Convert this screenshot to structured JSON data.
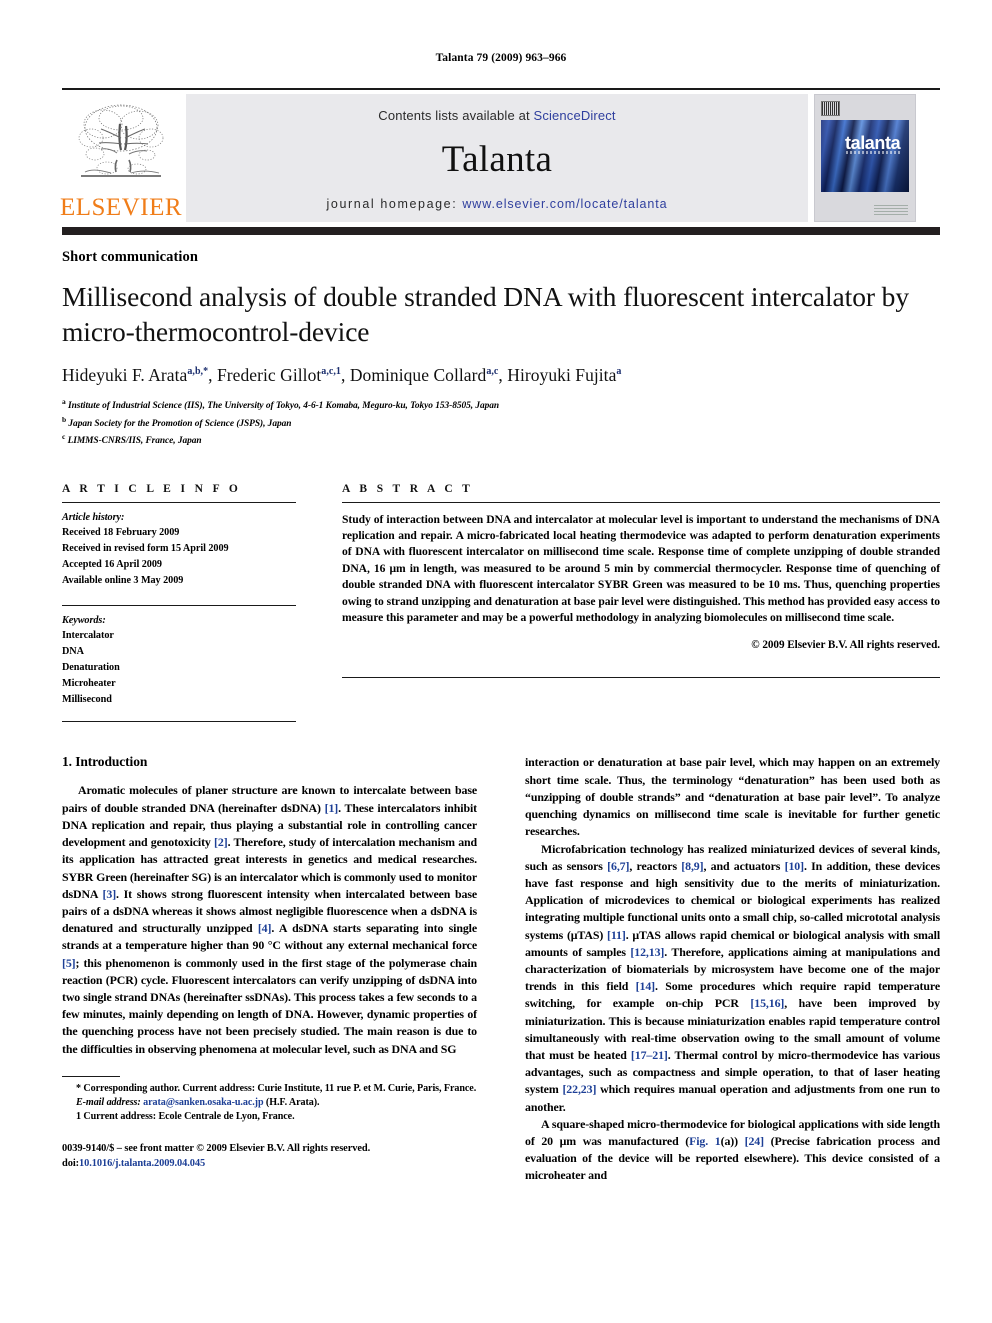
{
  "running_head": "Talanta 79 (2009) 963–966",
  "masthead": {
    "publisher_logo_text": "ELSEVIER",
    "contents_prefix": "Contents lists available at ",
    "contents_link": "ScienceDirect",
    "journal_name": "Talanta",
    "homepage_prefix": "journal homepage: ",
    "homepage_url": "www.elsevier.com/locate/talanta",
    "cover_title": "talanta",
    "accent_orange": "#f07d19",
    "link_blue": "#2f3f9e",
    "panel_gray": "#e9e9ec",
    "band_dark": "#231f20"
  },
  "doc_type": "Short communication",
  "title": "Millisecond analysis of double stranded DNA with fluorescent intercalator by micro-thermocontrol-device",
  "authors": [
    {
      "name": "Hideyuki F. Arata",
      "sup": "a,b,*"
    },
    {
      "name": "Frederic Gillot",
      "sup": "a,c,1"
    },
    {
      "name": "Dominique Collard",
      "sup": "a,c"
    },
    {
      "name": "Hiroyuki Fujita",
      "sup": "a"
    }
  ],
  "affiliations": [
    {
      "mark": "a",
      "text": "Institute of Industrial Science (IIS), The University of Tokyo, 4-6-1 Komaba, Meguro-ku, Tokyo 153-8505, Japan"
    },
    {
      "mark": "b",
      "text": "Japan Society for the Promotion of Science (JSPS), Japan"
    },
    {
      "mark": "c",
      "text": "LIMMS-CNRS/IIS, France, Japan"
    }
  ],
  "article_info": {
    "heading": "A R T I C L E    I N F O",
    "history_label": "Article history:",
    "history": [
      "Received 18 February 2009",
      "Received in revised form 15 April 2009",
      "Accepted 16 April 2009",
      "Available online 3 May 2009"
    ],
    "keywords_label": "Keywords:",
    "keywords": [
      "Intercalator",
      "DNA",
      "Denaturation",
      "Microheater",
      "Millisecond"
    ]
  },
  "abstract": {
    "heading": "A B S T R A C T",
    "text": "Study of interaction between DNA and intercalator at molecular level is important to understand the mechanisms of DNA replication and repair. A micro-fabricated local heating thermodevice was adapted to perform denaturation experiments of DNA with fluorescent intercalator on millisecond time scale. Response time of complete unzipping of double stranded DNA, 16 μm in length, was measured to be around 5 min by commercial thermocycler. Response time of quenching of double stranded DNA with fluorescent intercalator SYBR Green was measured to be 10 ms. Thus, quenching properties owing to strand unzipping and denaturation at base pair level were distinguished. This method has provided easy access to measure this parameter and may be a powerful methodology in analyzing biomolecules on millisecond time scale.",
    "copyright": "© 2009 Elsevier B.V. All rights reserved."
  },
  "body": {
    "section_heading": "1. Introduction",
    "left_paragraphs": [
      "Aromatic molecules of planer structure are known to intercalate between base pairs of double stranded DNA (hereinafter dsDNA) [1]. These intercalators inhibit DNA replication and repair, thus playing a substantial role in controlling cancer development and genotoxicity [2]. Therefore, study of intercalation mechanism and its application has attracted great interests in genetics and medical researches. SYBR Green (hereinafter SG) is an intercalator which is commonly used to monitor dsDNA [3]. It shows strong fluorescent intensity when intercalated between base pairs of a dsDNA whereas it shows almost negligible fluorescence when a dsDNA is denatured and structurally unzipped [4]. A dsDNA starts separating into single strands at a temperature higher than 90 °C without any external mechanical force [5]; this phenomenon is commonly used in the first stage of the polymerase chain reaction (PCR) cycle. Fluorescent intercalators can verify unzipping of dsDNA into two single strand DNAs (hereinafter ssDNAs). This process takes a few seconds to a few minutes, mainly depending on length of DNA. However, dynamic properties of the quenching process have not been precisely studied. The main reason is due to the difficulties in observing phenomena at molecular level, such as DNA and SG"
    ],
    "right_paragraphs": [
      "interaction or denaturation at base pair level, which may happen on an extremely short time scale. Thus, the terminology “denaturation” has been used both as “unzipping of double strands” and “denaturation at base pair level”. To analyze quenching dynamics on millisecond time scale is inevitable for further genetic researches.",
      "Microfabrication technology has realized miniaturized devices of several kinds, such as sensors [6,7], reactors [8,9], and actuators [10]. In addition, these devices have fast response and high sensitivity due to the merits of miniaturization. Application of microdevices to chemical or biological experiments has realized integrating multiple functional units onto a small chip, so-called micrototal analysis systems (μTAS) [11]. μTAS allows rapid chemical or biological analysis with small amounts of samples [12,13]. Therefore, applications aiming at manipulations and characterization of biomaterials by microsystem have become one of the major trends in this field [14]. Some procedures which require rapid temperature switching, for example on-chip PCR [15,16], have been improved by miniaturization. This is because miniaturization enables rapid temperature control simultaneously with real-time observation owing to the small amount of volume that must be heated [17–21]. Thermal control by micro-thermodevice has various advantages, such as compactness and simple operation, to that of laser heating system [22,23] which requires manual operation and adjustments from one run to another.",
      "A square-shaped micro-thermodevice for biological applications with side length of 20 μm was manufactured (Fig. 1(a)) [24] (Precise fabrication process and evaluation of the device will be reported elsewhere). This device consisted of a microheater and"
    ]
  },
  "footnotes": {
    "corresponding": "* Corresponding author. Current address: Curie Institute, 11 rue P. et M. Curie, Paris, France.",
    "email_label": "E-mail address:",
    "email": "arata@sanken.osaka-u.ac.jp",
    "email_suffix": " (H.F. Arata).",
    "note1": "1 Current address: Ecole Centrale de Lyon, France."
  },
  "imprint": {
    "line1": "0039-9140/$ – see front matter © 2009 Elsevier B.V. All rights reserved.",
    "doi_label": "doi:",
    "doi": "10.1016/j.talanta.2009.04.045"
  }
}
